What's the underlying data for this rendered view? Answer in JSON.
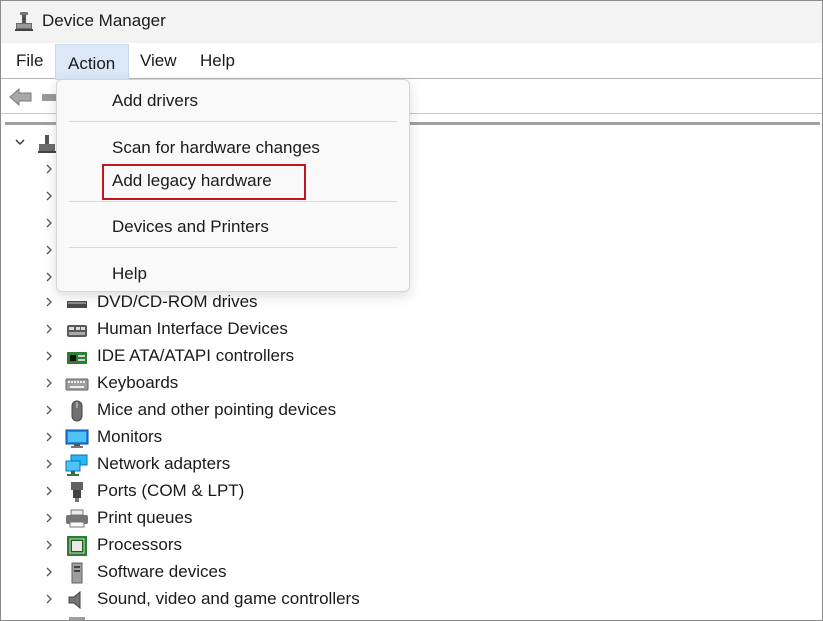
{
  "window": {
    "title": "Device Manager"
  },
  "menubar": {
    "items": [
      {
        "label": "File"
      },
      {
        "label": "Action"
      },
      {
        "label": "View"
      },
      {
        "label": "Help"
      }
    ]
  },
  "action_menu": {
    "items": [
      {
        "label": "Add drivers"
      },
      {
        "label": "Scan for hardware changes"
      },
      {
        "label": "Add legacy hardware",
        "highlighted": true
      },
      {
        "label": "Devices and Printers"
      },
      {
        "label": "Help"
      }
    ],
    "highlight_color": "#c0151b"
  },
  "tree": {
    "items": [
      {
        "label": "DVD/CD-ROM drives",
        "icon": "dvd-drive-icon"
      },
      {
        "label": "Human Interface Devices",
        "icon": "hid-icon"
      },
      {
        "label": "IDE ATA/ATAPI controllers",
        "icon": "ide-controller-icon"
      },
      {
        "label": "Keyboards",
        "icon": "keyboard-icon"
      },
      {
        "label": "Mice and other pointing devices",
        "icon": "mouse-icon"
      },
      {
        "label": "Monitors",
        "icon": "monitor-icon"
      },
      {
        "label": "Network adapters",
        "icon": "network-adapter-icon"
      },
      {
        "label": "Ports (COM & LPT)",
        "icon": "port-icon"
      },
      {
        "label": "Print queues",
        "icon": "printer-icon"
      },
      {
        "label": "Processors",
        "icon": "processor-icon"
      },
      {
        "label": "Software devices",
        "icon": "software-device-icon"
      },
      {
        "label": "Sound, video and game controllers",
        "icon": "sound-icon"
      }
    ]
  },
  "colors": {
    "titlebar_bg": "#f3f3f3",
    "menu_active_bg": "#dbe8f7",
    "highlight_border": "#c0151b"
  }
}
